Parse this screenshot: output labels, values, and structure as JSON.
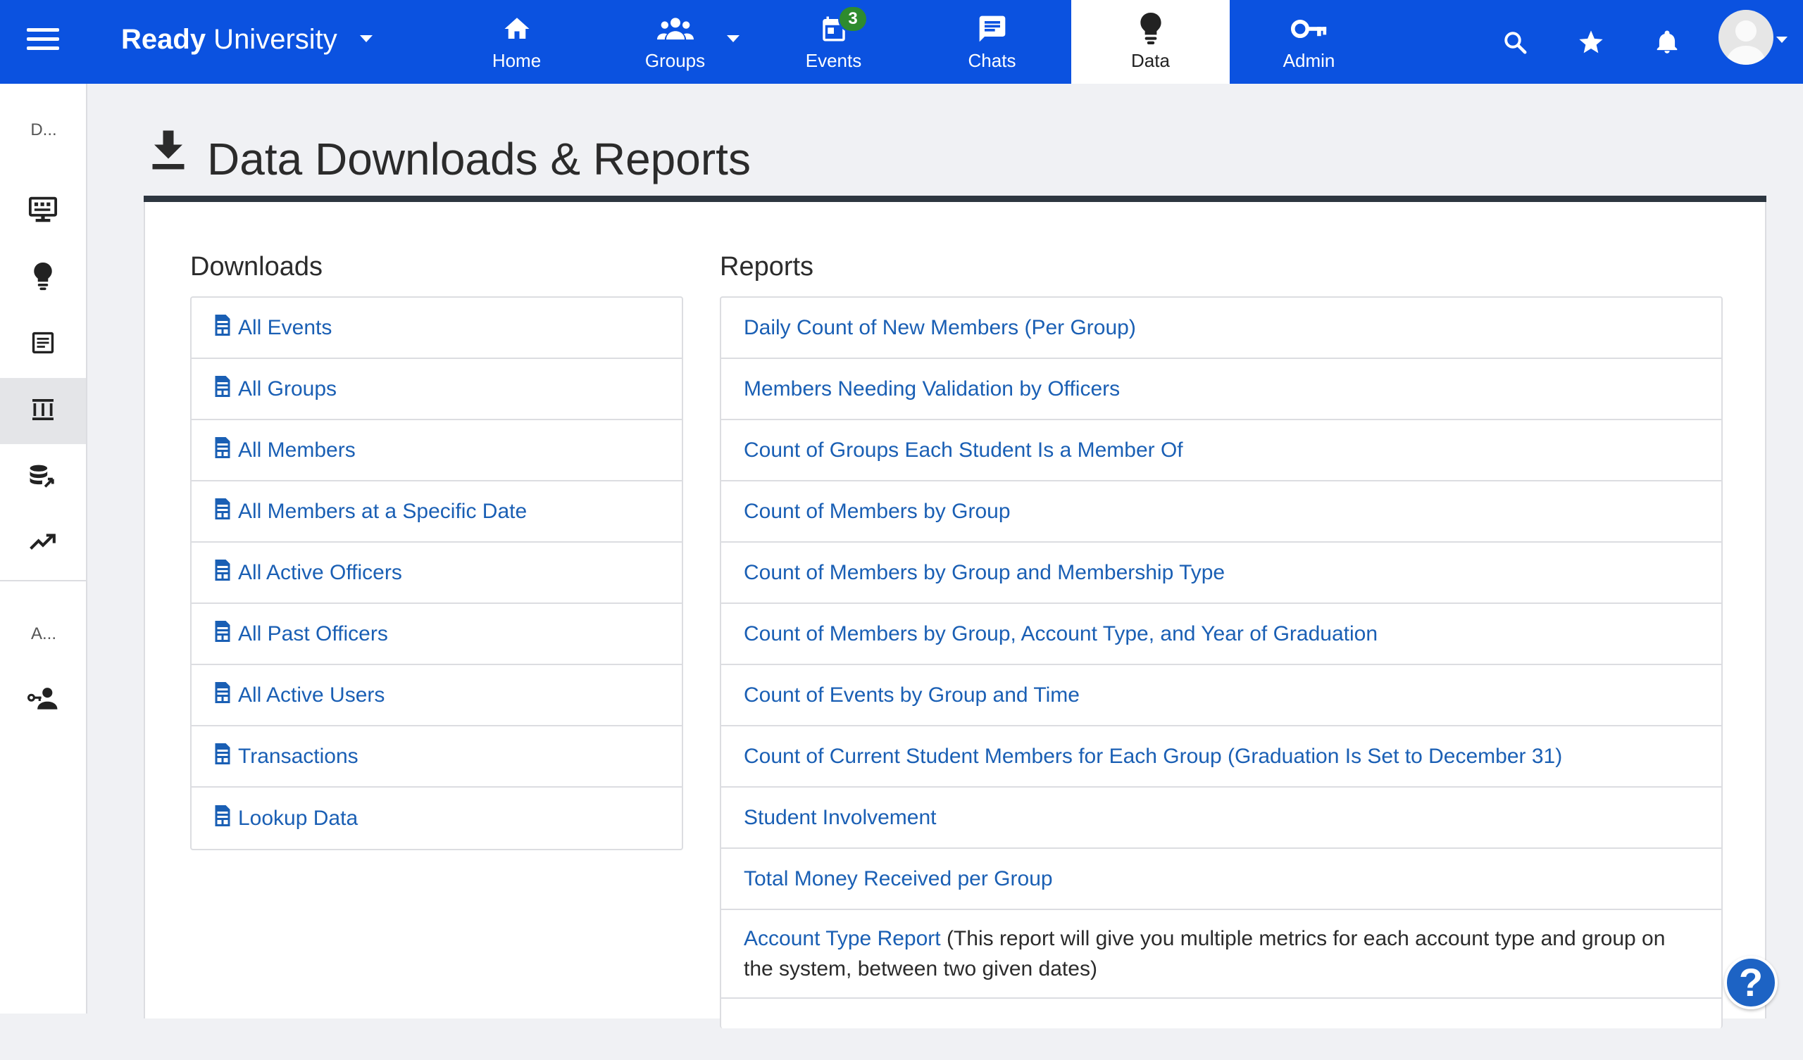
{
  "header": {
    "brand_bold": "Ready",
    "brand_rest": " University",
    "tabs": [
      {
        "label": "Home",
        "icon": "home-icon"
      },
      {
        "label": "Groups",
        "icon": "groups-icon"
      },
      {
        "label": "Events",
        "icon": "calendar-icon",
        "badge": "3"
      },
      {
        "label": "Chats",
        "icon": "chat-icon"
      },
      {
        "label": "Data",
        "icon": "lightbulb-icon",
        "active": true
      },
      {
        "label": "Admin",
        "icon": "key-icon"
      }
    ],
    "right_icons": [
      "search-icon",
      "star-icon",
      "bell-icon"
    ],
    "colors": {
      "nav_bg": "#0b52e0",
      "badge": "#2e8b2e",
      "link": "#1a5fb4"
    }
  },
  "sidebar": {
    "section1_label": "D...",
    "section2_label": "A...",
    "items": [
      {
        "icon": "monitor-icon"
      },
      {
        "icon": "lightbulb-icon"
      },
      {
        "icon": "document-icon"
      },
      {
        "icon": "columns-icon",
        "active": true
      },
      {
        "icon": "database-icon"
      },
      {
        "icon": "trending-icon"
      },
      {
        "icon": "user-key-icon"
      }
    ]
  },
  "page": {
    "title": "Data Downloads & Reports",
    "title_icon": "download-icon"
  },
  "downloads": {
    "heading": "Downloads",
    "items": [
      "All Events",
      "All Groups",
      "All Members",
      "All Members at a Specific Date",
      "All Active Officers",
      "All Past Officers",
      "All Active Users",
      "Transactions",
      "Lookup Data"
    ]
  },
  "reports": {
    "heading": "Reports",
    "items": [
      "Daily Count of New Members (Per Group)",
      "Members Needing Validation by Officers",
      "Count of Groups Each Student Is a Member Of",
      "Count of Members by Group",
      "Count of Members by Group and Membership Type",
      "Count of Members by Group, Account Type, and Year of Graduation",
      "Count of Events by Group and Time",
      "Count of Current Student Members for Each Group (Graduation Is Set to December 31)",
      "Student Involvement",
      "Total Money Received per Group"
    ],
    "account_type_link": "Account Type Report",
    "account_type_desc": " (This report will give you multiple metrics for each account type and group on the system, between two given dates)"
  },
  "help": {
    "label": "?"
  }
}
